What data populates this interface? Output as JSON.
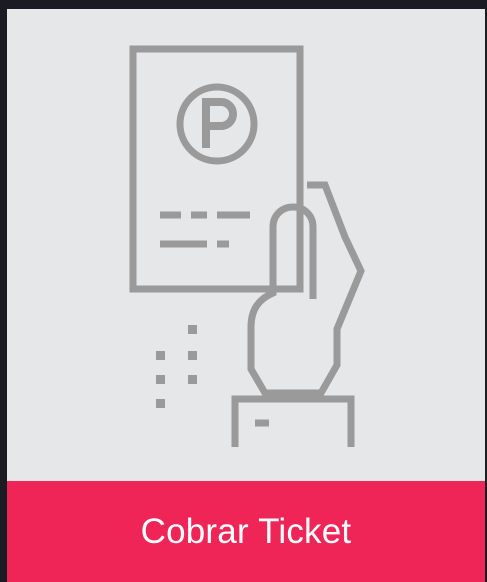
{
  "tile": {
    "label": "Cobrar Ticket",
    "icon": "parking-ticket-hand-icon",
    "icon_glyph": "P"
  },
  "colors": {
    "background_frame": "#1b1b23",
    "tile_background": "#e6e7e9",
    "icon_stroke": "#9a9a9a",
    "accent_bar": "#ef2457",
    "label_text": "#ffffff"
  }
}
